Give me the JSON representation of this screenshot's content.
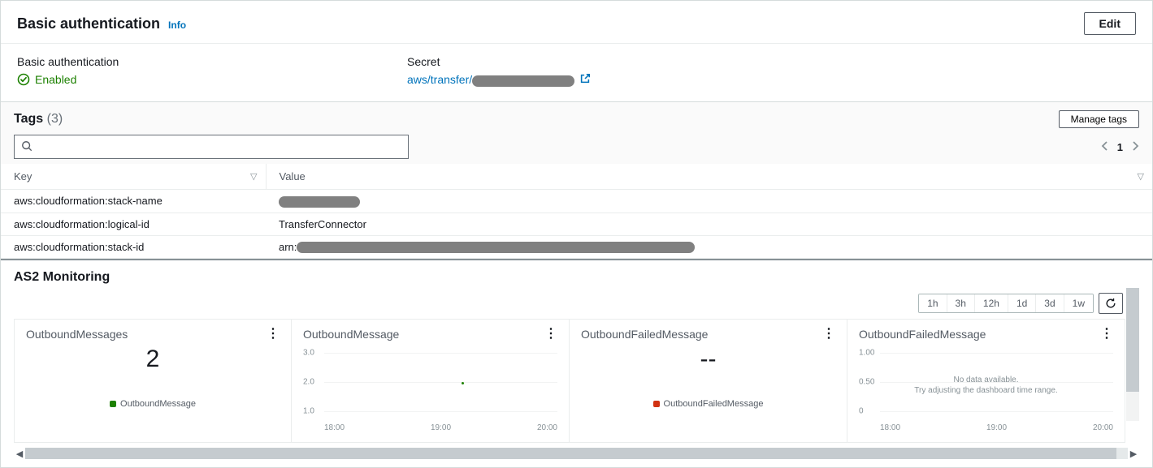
{
  "basic_auth": {
    "title": "Basic authentication",
    "info_label": "Info",
    "edit_label": "Edit",
    "status_label": "Basic authentication",
    "status_value": "Enabled",
    "secret_label": "Secret",
    "secret_prefix": "aws/transfer/"
  },
  "tags": {
    "title": "Tags",
    "count_label": "(3)",
    "manage_label": "Manage tags",
    "page_number": "1",
    "columns": {
      "key": "Key",
      "value": "Value"
    },
    "rows": [
      {
        "key": "aws:cloudformation:stack-name",
        "value_prefix": "",
        "redacted": true,
        "redact_width": 100
      },
      {
        "key": "aws:cloudformation:logical-id",
        "value_prefix": "TransferConnector",
        "redacted": false,
        "redact_width": 0
      },
      {
        "key": "aws:cloudformation:stack-id",
        "value_prefix": "arn:",
        "redacted": true,
        "redact_width": 490
      }
    ]
  },
  "monitoring": {
    "title": "AS2 Monitoring",
    "ranges": [
      "1h",
      "3h",
      "12h",
      "1d",
      "3d",
      "1w"
    ],
    "charts": [
      {
        "title": "OutboundMessages",
        "kind": "number",
        "value": "2",
        "legend_label": "OutboundMessage",
        "legend_color": "#1d8102"
      },
      {
        "title": "OutboundMessage",
        "kind": "line",
        "y_ticks": [
          "3.0",
          "2.0",
          "1.0"
        ],
        "x_ticks": [
          "18:00",
          "19:00",
          "20:00"
        ],
        "point": {
          "x_pct": 54,
          "y_tick_index": 1
        }
      },
      {
        "title": "OutboundFailedMessage",
        "kind": "number",
        "value": "--",
        "legend_label": "OutboundFailedMessage",
        "legend_color": "#d13212"
      },
      {
        "title": "OutboundFailedMessage",
        "kind": "empty",
        "y_ticks": [
          "1.00",
          "0.50",
          "0"
        ],
        "x_ticks": [
          "18:00",
          "19:00",
          "20:00"
        ],
        "nodata_line1": "No data available.",
        "nodata_line2": "Try adjusting the dashboard time range."
      }
    ]
  },
  "chart_data": [
    {
      "type": "table",
      "title": "OutboundMessages",
      "value": 2,
      "legend": "OutboundMessage"
    },
    {
      "type": "line",
      "title": "OutboundMessage",
      "x": [
        "18:00",
        "19:00",
        "20:00"
      ],
      "ylim": [
        1.0,
        3.0
      ],
      "series": [
        {
          "name": "OutboundMessage",
          "points": [
            {
              "x": "~18:50",
              "y": 2.0
            }
          ]
        }
      ]
    },
    {
      "type": "table",
      "title": "OutboundFailedMessage",
      "value": null,
      "display": "--",
      "legend": "OutboundFailedMessage"
    },
    {
      "type": "line",
      "title": "OutboundFailedMessage",
      "x": [
        "18:00",
        "19:00",
        "20:00"
      ],
      "ylim": [
        0,
        1.0
      ],
      "series": [],
      "note": "No data available."
    }
  ]
}
